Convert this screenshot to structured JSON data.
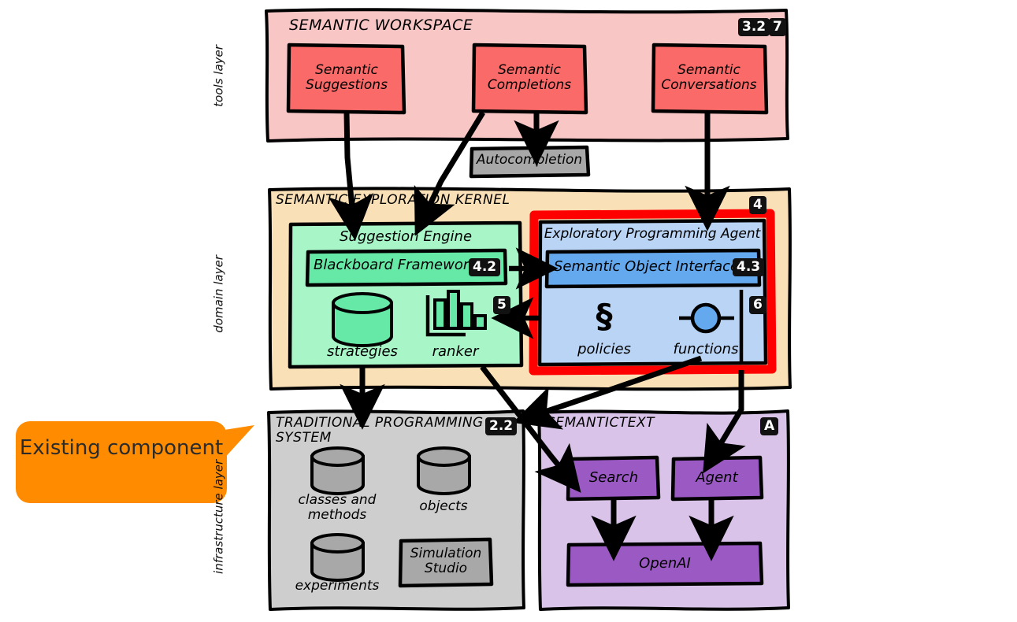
{
  "diagram": {
    "title_style": "hand-drawn architecture diagram",
    "layers": [
      {
        "id": "tools",
        "label": "tools layer"
      },
      {
        "id": "domain",
        "label": "domain layer"
      },
      {
        "id": "infrastructure",
        "label": "infrastructure layer"
      }
    ],
    "colors": {
      "tools_panel": "#F9C6C6",
      "tools_box": "#FA6A68",
      "domain_panel": "#FAE0B6",
      "engine_box": "#A8F5C8",
      "engine_inner": "#66E9A6",
      "agent_outline": "#FF0000",
      "agent_box": "#B9D4F4",
      "agent_inner": "#64A8EE",
      "infra_panel": "#CECECE",
      "infra_box": "#A8A8A8",
      "semantictext_panel": "#D9C3E8",
      "semantictext_box": "#9B59C4",
      "callout": "#FF8C00",
      "badge": "#111111"
    },
    "panels": {
      "workspace": {
        "title": "SEMANTIC WORKSPACE",
        "badges": [
          "3.2",
          "7"
        ],
        "boxes": [
          {
            "id": "semantic-suggestions",
            "label": "Semantic\nSuggestions"
          },
          {
            "id": "semantic-completions",
            "label": "Semantic\nCompletions"
          },
          {
            "id": "semantic-conversations",
            "label": "Semantic\nConversations"
          }
        ]
      },
      "autocompletion": {
        "label": "Autocompletion"
      },
      "kernel": {
        "title": "SEMANTIC EXPLORATION KERNEL",
        "badges": [
          "4"
        ],
        "suggestion_engine": {
          "title": "Suggestion Engine",
          "badges": [
            "5"
          ],
          "inner": {
            "label": "Blackboard Framework",
            "badge": "4.2"
          },
          "items": [
            {
              "id": "strategies",
              "label": "strategies",
              "icon": "database-icon"
            },
            {
              "id": "ranker",
              "label": "ranker",
              "icon": "bar-chart-icon"
            }
          ]
        },
        "agent": {
          "title": "Exploratory Programming Agent",
          "badges": [
            "6"
          ],
          "inner": {
            "label": "Semantic Object Interfaces",
            "badge": "4.3"
          },
          "items": [
            {
              "id": "policies",
              "label": "policies",
              "icon": "section-sign-icon"
            },
            {
              "id": "functions",
              "label": "functions",
              "icon": "function-node-icon"
            }
          ]
        }
      },
      "traditional": {
        "title": "TRADITIONAL PROGRAMMING\nSYSTEM",
        "badges": [
          "2.2"
        ],
        "items": [
          {
            "id": "classes-and-methods",
            "label": "classes and\nmethods",
            "icon": "database-icon"
          },
          {
            "id": "objects",
            "label": "objects",
            "icon": "database-icon"
          },
          {
            "id": "experiments",
            "label": "experiments",
            "icon": "database-icon"
          },
          {
            "id": "simulation-studio",
            "label": "Simulation\nStudio",
            "icon": "box-icon"
          }
        ]
      },
      "semantictext": {
        "title": "SEMANTICTEXT",
        "badges": [
          "A"
        ],
        "boxes": [
          {
            "id": "search",
            "label": "Search"
          },
          {
            "id": "agent",
            "label": "Agent"
          },
          {
            "id": "openai",
            "label": "OpenAI"
          }
        ]
      }
    },
    "callout": {
      "label": "Existing\ncomponent"
    }
  }
}
